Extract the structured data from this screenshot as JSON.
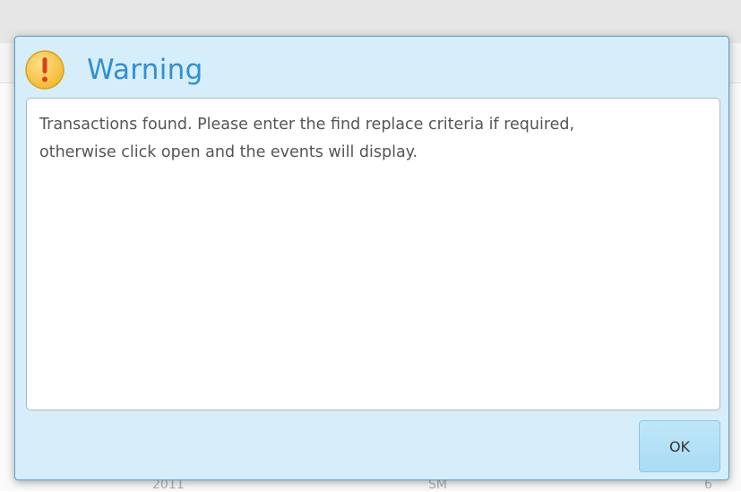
{
  "background": {
    "row_cells": [
      "2011",
      "SM",
      "6"
    ]
  },
  "dialog": {
    "icon": "exclamation-warning-icon",
    "title": "Warning",
    "message_line1": "Transactions found. Please enter the find replace criteria if required,",
    "message_line2": "otherwise click open and the events will display.",
    "ok_label": "OK"
  },
  "colors": {
    "title": "#2f8fd6",
    "dialog_bg": "#d6eef9",
    "icon_fill": "#f7c84a",
    "button_bg": "#b6e0f6"
  }
}
